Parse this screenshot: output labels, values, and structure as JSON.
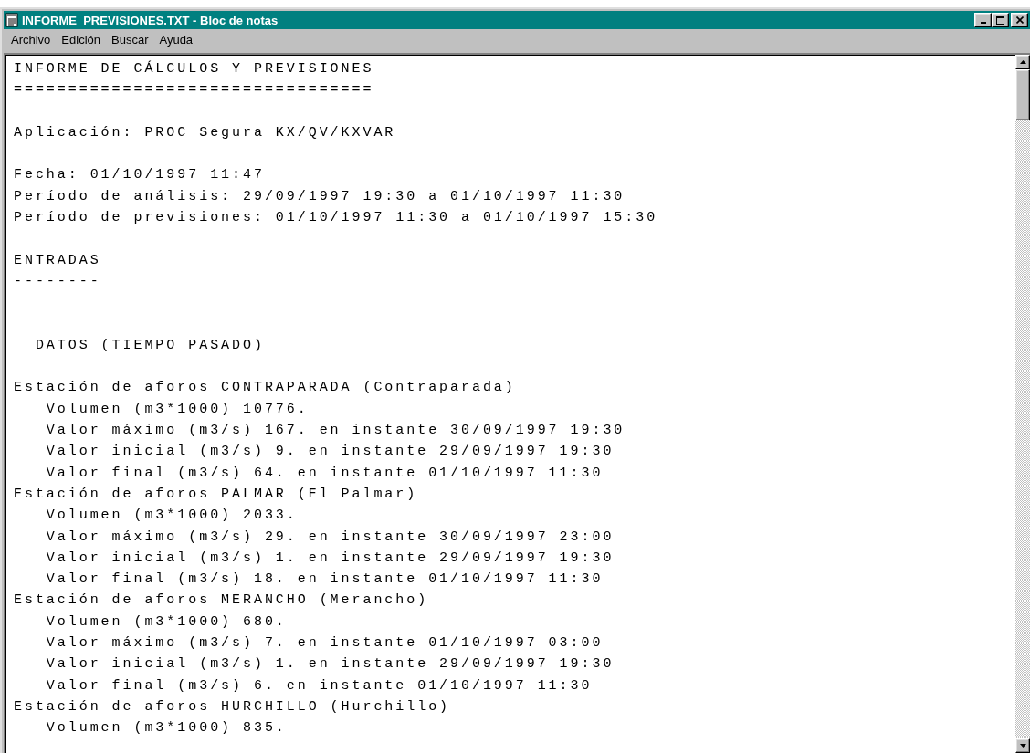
{
  "window": {
    "title": "INFORME_PREVISIONES.TXT - Bloc de notas",
    "active": true
  },
  "menu": [
    {
      "label": "Archivo"
    },
    {
      "label": "Edición"
    },
    {
      "label": "Buscar"
    },
    {
      "label": "Ayuda"
    }
  ],
  "document": {
    "lines": [
      {
        "kind": "text",
        "text": "INFORME DE CÁLCULOS Y PREVISIONES"
      },
      {
        "kind": "text",
        "text": "================================="
      },
      {
        "kind": "blank"
      },
      {
        "kind": "text",
        "text": "Aplicación: PROC Segura KX/QV/KXVAR"
      },
      {
        "kind": "blank"
      },
      {
        "kind": "text",
        "text": "Fecha: 01/10/1997 11:47"
      },
      {
        "kind": "text",
        "text": "Período de análisis: 29/09/1997 19:30 a 01/10/1997 11:30"
      },
      {
        "kind": "text",
        "text": "Período de previsiones: 01/10/1997 11:30 a 01/10/1997 15:30"
      },
      {
        "kind": "blank"
      },
      {
        "kind": "text",
        "text": "ENTRADAS"
      },
      {
        "kind": "text",
        "text": "--------"
      },
      {
        "kind": "blank"
      },
      {
        "kind": "blank"
      },
      {
        "kind": "text",
        "text": "  DATOS (TIEMPO PASADO)"
      },
      {
        "kind": "blank"
      },
      {
        "kind": "text",
        "text": "Estación de aforos CONTRAPARADA (Contraparada)"
      },
      {
        "kind": "text",
        "text": "   Volumen (m3*1000) 10776."
      },
      {
        "kind": "text",
        "text": "   Valor máximo (m3/s) 167. en instante 30/09/1997 19:30"
      },
      {
        "kind": "text",
        "text": "   Valor inicial (m3/s) 9. en instante 29/09/1997 19:30"
      },
      {
        "kind": "text",
        "text": "   Valor final (m3/s) 64. en instante 01/10/1997 11:30"
      },
      {
        "kind": "text",
        "text": "Estación de aforos PALMAR (El Palmar)"
      },
      {
        "kind": "text",
        "text": "   Volumen (m3*1000) 2033."
      },
      {
        "kind": "text",
        "text": "   Valor máximo (m3/s) 29. en instante 30/09/1997 23:00"
      },
      {
        "kind": "text",
        "text": "   Valor inicial (m3/s) 1. en instante 29/09/1997 19:30"
      },
      {
        "kind": "text",
        "text": "   Valor final (m3/s) 18. en instante 01/10/1997 11:30"
      },
      {
        "kind": "text",
        "text": "Estación de aforos MERANCHO (Merancho)"
      },
      {
        "kind": "text",
        "text": "   Volumen (m3*1000) 680."
      },
      {
        "kind": "text",
        "text": "   Valor máximo (m3/s) 7. en instante 01/10/1997 03:00"
      },
      {
        "kind": "text",
        "text": "   Valor inicial (m3/s) 1. en instante 29/09/1997 19:30"
      },
      {
        "kind": "text",
        "text": "   Valor final (m3/s) 6. en instante 01/10/1997 11:30"
      },
      {
        "kind": "text",
        "text": "Estación de aforos HURCHILLO (Hurchillo)"
      },
      {
        "kind": "text",
        "text": "   Volumen (m3*1000) 835."
      }
    ]
  }
}
